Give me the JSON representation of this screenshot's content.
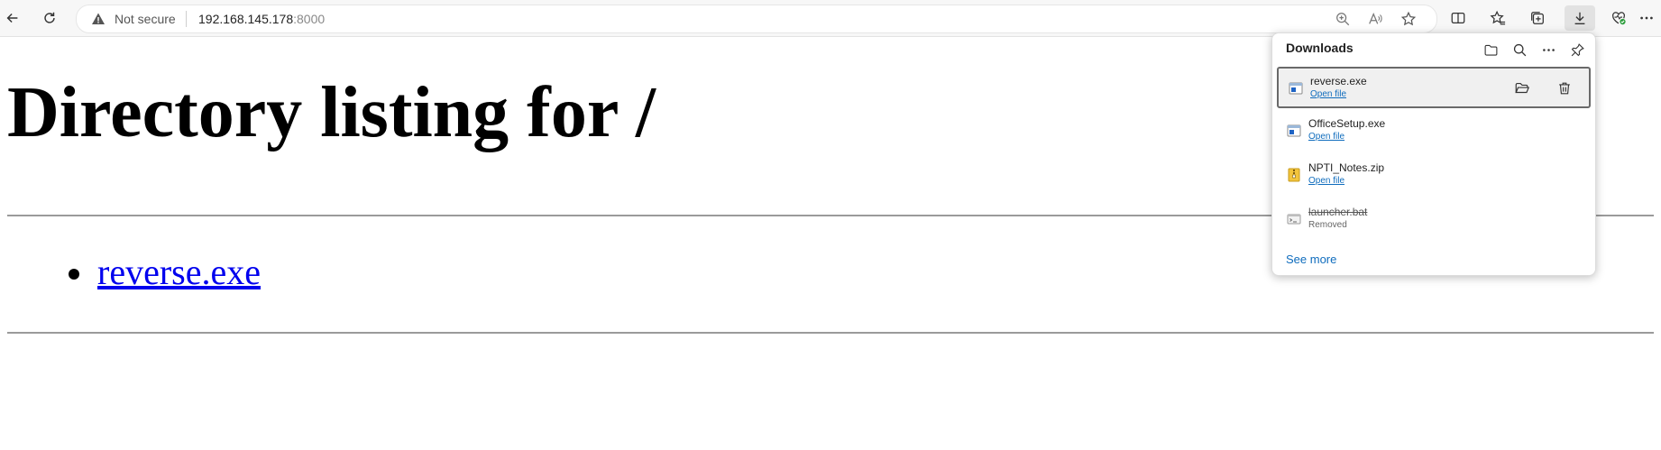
{
  "browser": {
    "security_label": "Not secure",
    "url_host": "192.168.145.178",
    "url_port": ":8000",
    "icons": [
      "back-icon",
      "refresh-icon",
      "warning-icon",
      "zoom-icon",
      "read-aloud-icon",
      "favorite-star-icon",
      "split-screen-icon",
      "favorites-icon",
      "collections-icon",
      "download-icon",
      "browser-essentials-icon",
      "more-icon"
    ]
  },
  "page": {
    "heading": "Directory listing for /",
    "files": [
      {
        "name": "reverse.exe"
      }
    ]
  },
  "downloads": {
    "title": "Downloads",
    "header_icons": [
      "folder-icon",
      "search-icon",
      "more-icon",
      "pin-icon"
    ],
    "items": [
      {
        "name": "reverse.exe",
        "action": "Open file",
        "status": "",
        "icon": "exe-file-icon"
      },
      {
        "name": "OfficeSetup.exe",
        "action": "Open file",
        "status": "",
        "icon": "exe-file-icon"
      },
      {
        "name": "NPTI_Notes.zip",
        "action": "Open file",
        "status": "",
        "icon": "zip-file-icon"
      },
      {
        "name": "launcher.bat",
        "action": "",
        "status": "Removed",
        "icon": "bat-file-icon"
      }
    ],
    "see_more": "See more"
  },
  "colors": {
    "link": "#0000ee",
    "edge_link": "#0f6cbd",
    "badge_green": "#2e9e3e"
  }
}
